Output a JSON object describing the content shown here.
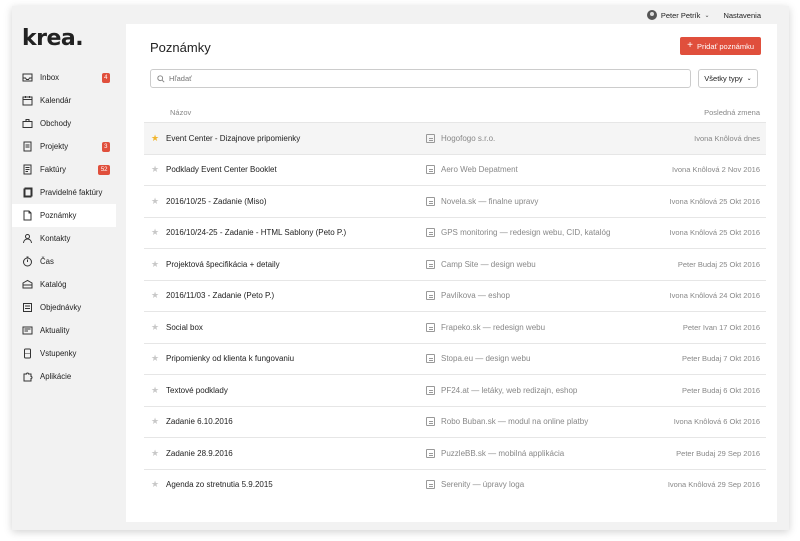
{
  "app": {
    "logo": "krea."
  },
  "topbar": {
    "user_name": "Peter Petrík",
    "settings_label": "Nastavenia"
  },
  "sidebar": {
    "items": [
      {
        "label": "Inbox",
        "badge": "4",
        "icon": "inbox-icon"
      },
      {
        "label": "Kalendár",
        "badge": "",
        "icon": "calendar-icon"
      },
      {
        "label": "Obchody",
        "badge": "",
        "icon": "briefcase-icon"
      },
      {
        "label": "Projekty",
        "badge": "3",
        "icon": "projects-icon"
      },
      {
        "label": "Faktúry",
        "badge": "52",
        "icon": "invoice-icon"
      },
      {
        "label": "Pravidelné faktúry",
        "badge": "",
        "icon": "recurring-invoice-icon"
      },
      {
        "label": "Poznámky",
        "badge": "",
        "icon": "note-icon",
        "active": true
      },
      {
        "label": "Kontakty",
        "badge": "",
        "icon": "contacts-icon"
      },
      {
        "label": "Čas",
        "badge": "",
        "icon": "timer-icon"
      },
      {
        "label": "Katalóg",
        "badge": "",
        "icon": "catalog-icon"
      },
      {
        "label": "Objednávky",
        "badge": "",
        "icon": "orders-icon"
      },
      {
        "label": "Aktuality",
        "badge": "",
        "icon": "news-icon"
      },
      {
        "label": "Vstupenky",
        "badge": "",
        "icon": "ticket-icon"
      },
      {
        "label": "Aplikácie",
        "badge": "",
        "icon": "puzzle-icon"
      }
    ]
  },
  "main": {
    "title": "Poznámky",
    "add_button_label": "Pridať poznámku",
    "search_placeholder": "Hľadať",
    "type_filter": "Všetky typy",
    "columns": {
      "name": "Názov",
      "last_change": "Posledná zmena"
    },
    "rows": [
      {
        "starred": true,
        "name": "Event Center - Dizajnove pripomienky",
        "project": "Hogofogo s.r.o.",
        "changed": "Ivona Knôlová dnes"
      },
      {
        "starred": false,
        "name": "Podklady Event Center Booklet",
        "project": "Aero Web Depatment",
        "changed": "Ivona Knôlová 2 Nov 2016"
      },
      {
        "starred": false,
        "name": "2016/10/25 - Zadanie (Miso)",
        "project": "Novela.sk — finalne upravy",
        "changed": "Ivona Knôlová 25 Okt 2016"
      },
      {
        "starred": false,
        "name": "2016/10/24-25 - Zadanie - HTML Sablony (Peto P.)",
        "project": "GPS monitoring — redesign webu, CID, katalóg",
        "changed": "Ivona Knôlová 25 Okt 2016"
      },
      {
        "starred": false,
        "name": "Projektová špecifikácia + detaily",
        "project": "Camp Site — design webu",
        "changed": "Peter Budaj 25 Okt 2016"
      },
      {
        "starred": false,
        "name": "2016/11/03 - Zadanie (Peto P.)",
        "project": "Pavlíkova — eshop",
        "changed": "Ivona Knôlová 24 Okt 2016"
      },
      {
        "starred": false,
        "name": "Social box",
        "project": "Frapeko.sk — redesign webu",
        "changed": "Peter Ivan 17 Okt 2016"
      },
      {
        "starred": false,
        "name": "Pripomienky od klienta k fungovaniu",
        "project": "Stopa.eu — design webu",
        "changed": "Peter Budaj 7 Okt 2016"
      },
      {
        "starred": false,
        "name": "Textové podklady",
        "project": "PF24.at — letáky, web redizajn, eshop",
        "changed": "Peter Budaj 6 Okt 2016"
      },
      {
        "starred": false,
        "name": "Zadanie 6.10.2016",
        "project": "Robo Buban.sk — modul na online platby",
        "changed": "Ivona Knôlová 6 Okt 2016"
      },
      {
        "starred": false,
        "name": "Zadanie 28.9.2016",
        "project": "PuzzleBB.sk — mobilná applikácia",
        "changed": "Peter Budaj 29 Sep 2016"
      },
      {
        "starred": false,
        "name": "Agenda zo stretnutia 5.9.2015",
        "project": "Serenity — úpravy loga",
        "changed": "Ivona Knôlová 29 Sep 2016"
      }
    ]
  },
  "colors": {
    "accent": "#e04f3c",
    "star": "#f1b52d"
  }
}
